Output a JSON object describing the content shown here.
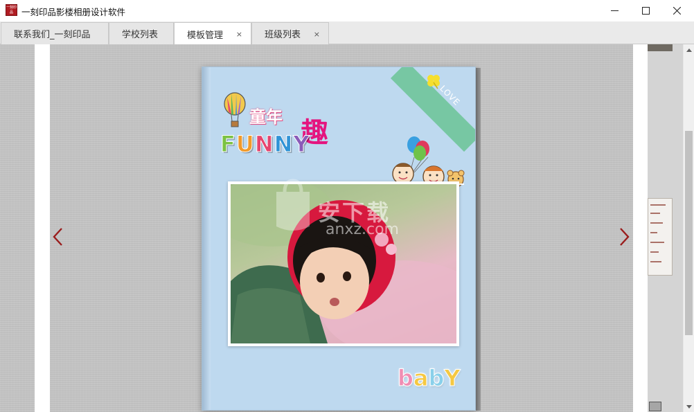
{
  "window": {
    "title": "一刻印品影楼相册设计软件",
    "logo_text": "一刻印品"
  },
  "tabs": [
    {
      "label": "联系我们_一刻印品",
      "closable": false,
      "active": false
    },
    {
      "label": "学校列表",
      "closable": false,
      "active": false
    },
    {
      "label": "模板管理",
      "closable": true,
      "active": true
    },
    {
      "label": "班级列表",
      "closable": true,
      "active": false
    }
  ],
  "tab_close_glyph": "×",
  "cover": {
    "title_cn_small": "童年",
    "title_cn_big": "趣",
    "title_funny": [
      "F",
      "U",
      "N",
      "N",
      "Y"
    ],
    "funny_colors": [
      "#7cc243",
      "#f19a2a",
      "#e6446e",
      "#2f93d6",
      "#8a5bb8"
    ],
    "ribbon_text": "LOVE",
    "baby_letters": [
      "b",
      "a",
      "b",
      "Y"
    ],
    "baby_colors": [
      "#f08db3",
      "#f5c842",
      "#8ad0ea",
      "#f5c842"
    ],
    "background_color": "#bed9ef"
  },
  "watermark": {
    "text": "安下载",
    "url": "anxz.com"
  },
  "colors": {
    "nav_arrow": "#9a1c1c",
    "ribbon": "#77c7a3"
  }
}
